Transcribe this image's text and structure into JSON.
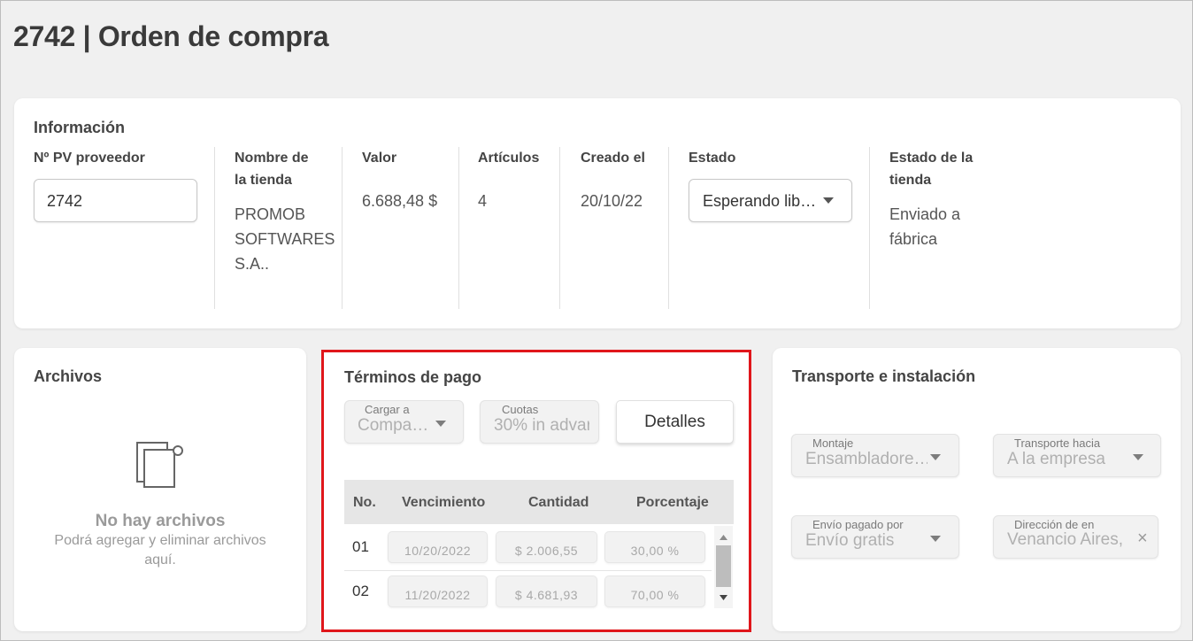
{
  "page": {
    "title": "2742 | Orden de compra"
  },
  "info": {
    "section_title": "Información",
    "supplier_pv": {
      "label": "Nº PV proveedor",
      "value": "2742"
    },
    "store_name": {
      "label_line1": "Nombre de",
      "label_line2": "la tienda",
      "value_line1": "PROMOB",
      "value_line2": "SOFTWARES",
      "value_line3": "S.A.."
    },
    "amount": {
      "label": "Valor",
      "value": "6.688,48 $"
    },
    "articles": {
      "label": "Artículos",
      "value": "4"
    },
    "created": {
      "label": "Creado el",
      "value": "20/10/22"
    },
    "status": {
      "label": "Estado",
      "value": "Esperando lib…"
    },
    "store_status": {
      "label_line1": "Estado de la",
      "label_line2": "tienda",
      "value_line1": "Enviado a",
      "value_line2": "fábrica"
    }
  },
  "files": {
    "title": "Archivos",
    "empty_title": "No hay archivos",
    "empty_sub_line1": "Podrá agregar y eliminar archivos",
    "empty_sub_line2": "aquí."
  },
  "payment_terms": {
    "title": "Términos de pago",
    "charge_to": {
      "label": "Cargar a",
      "value": "Compa…"
    },
    "installments": {
      "label": "Cuotas",
      "value": "30% in advar"
    },
    "details_button": "Detalles",
    "columns": [
      "No.",
      "Vencimiento",
      "Cantidad",
      "Porcentaje"
    ],
    "rows": [
      {
        "no": "01",
        "due": "10/20/2022",
        "amount": "$ 2.006,55",
        "percent": "30,00 %"
      },
      {
        "no": "02",
        "due": "11/20/2022",
        "amount": "$ 4.681,93",
        "percent": "70,00 %"
      }
    ]
  },
  "transport": {
    "title": "Transporte e instalación",
    "assembly": {
      "label": "Montaje",
      "value": "Ensambladore…"
    },
    "transport_to": {
      "label": "Transporte hacia",
      "value": "A la empresa"
    },
    "shipping_paid_by": {
      "label": "Envío pagado por",
      "value": "Envío gratis"
    },
    "address": {
      "label": "Dirección de en",
      "value": "Venancio Aires,"
    }
  },
  "colors": {
    "highlight": "#e0161b",
    "background": "#f0f0f0",
    "card": "#ffffff"
  }
}
